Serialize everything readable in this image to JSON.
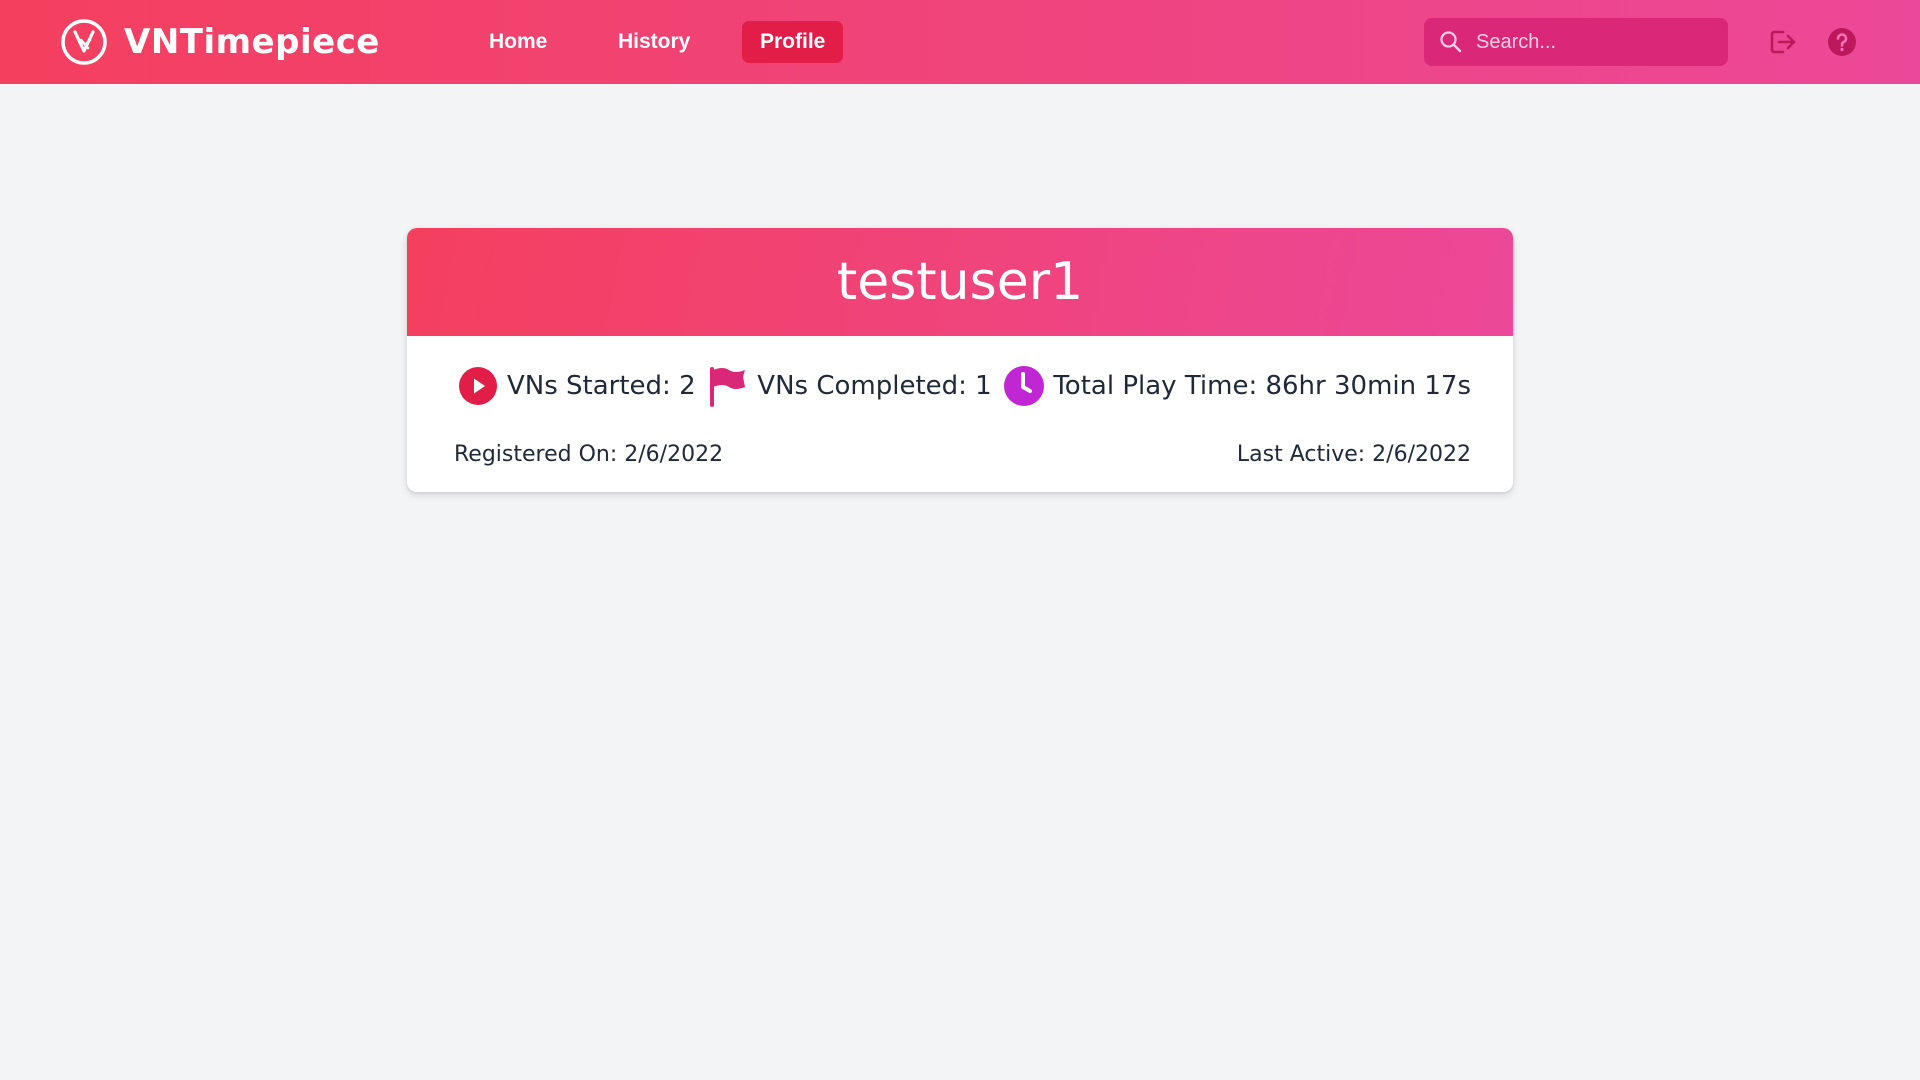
{
  "app": {
    "brand_name": "VNTimepiece",
    "brand_color": "#f43f5e",
    "accent_color": "#ec4899"
  },
  "nav": {
    "items": [
      {
        "label": "Home",
        "active": false
      },
      {
        "label": "History",
        "active": false
      },
      {
        "label": "Profile",
        "active": true
      }
    ]
  },
  "search": {
    "placeholder": "Search...",
    "value": "",
    "icon": "search-icon"
  },
  "header_actions": {
    "logout_icon": "logout-icon",
    "help_icon": "help-icon"
  },
  "profile": {
    "username": "testuser1",
    "stats": [
      {
        "icon": "play-circle-icon",
        "color": "#e11d48",
        "text": "VNs Started: 2"
      },
      {
        "icon": "flag-icon",
        "color": "#db2777",
        "text": "VNs Completed: 1"
      },
      {
        "icon": "clock-icon",
        "color": "#c026d3",
        "text": "Total Play Time: 86hr 30min 17s"
      }
    ],
    "registered": "Registered On: 2/6/2022",
    "last_active": "Last Active: 2/6/2022"
  }
}
